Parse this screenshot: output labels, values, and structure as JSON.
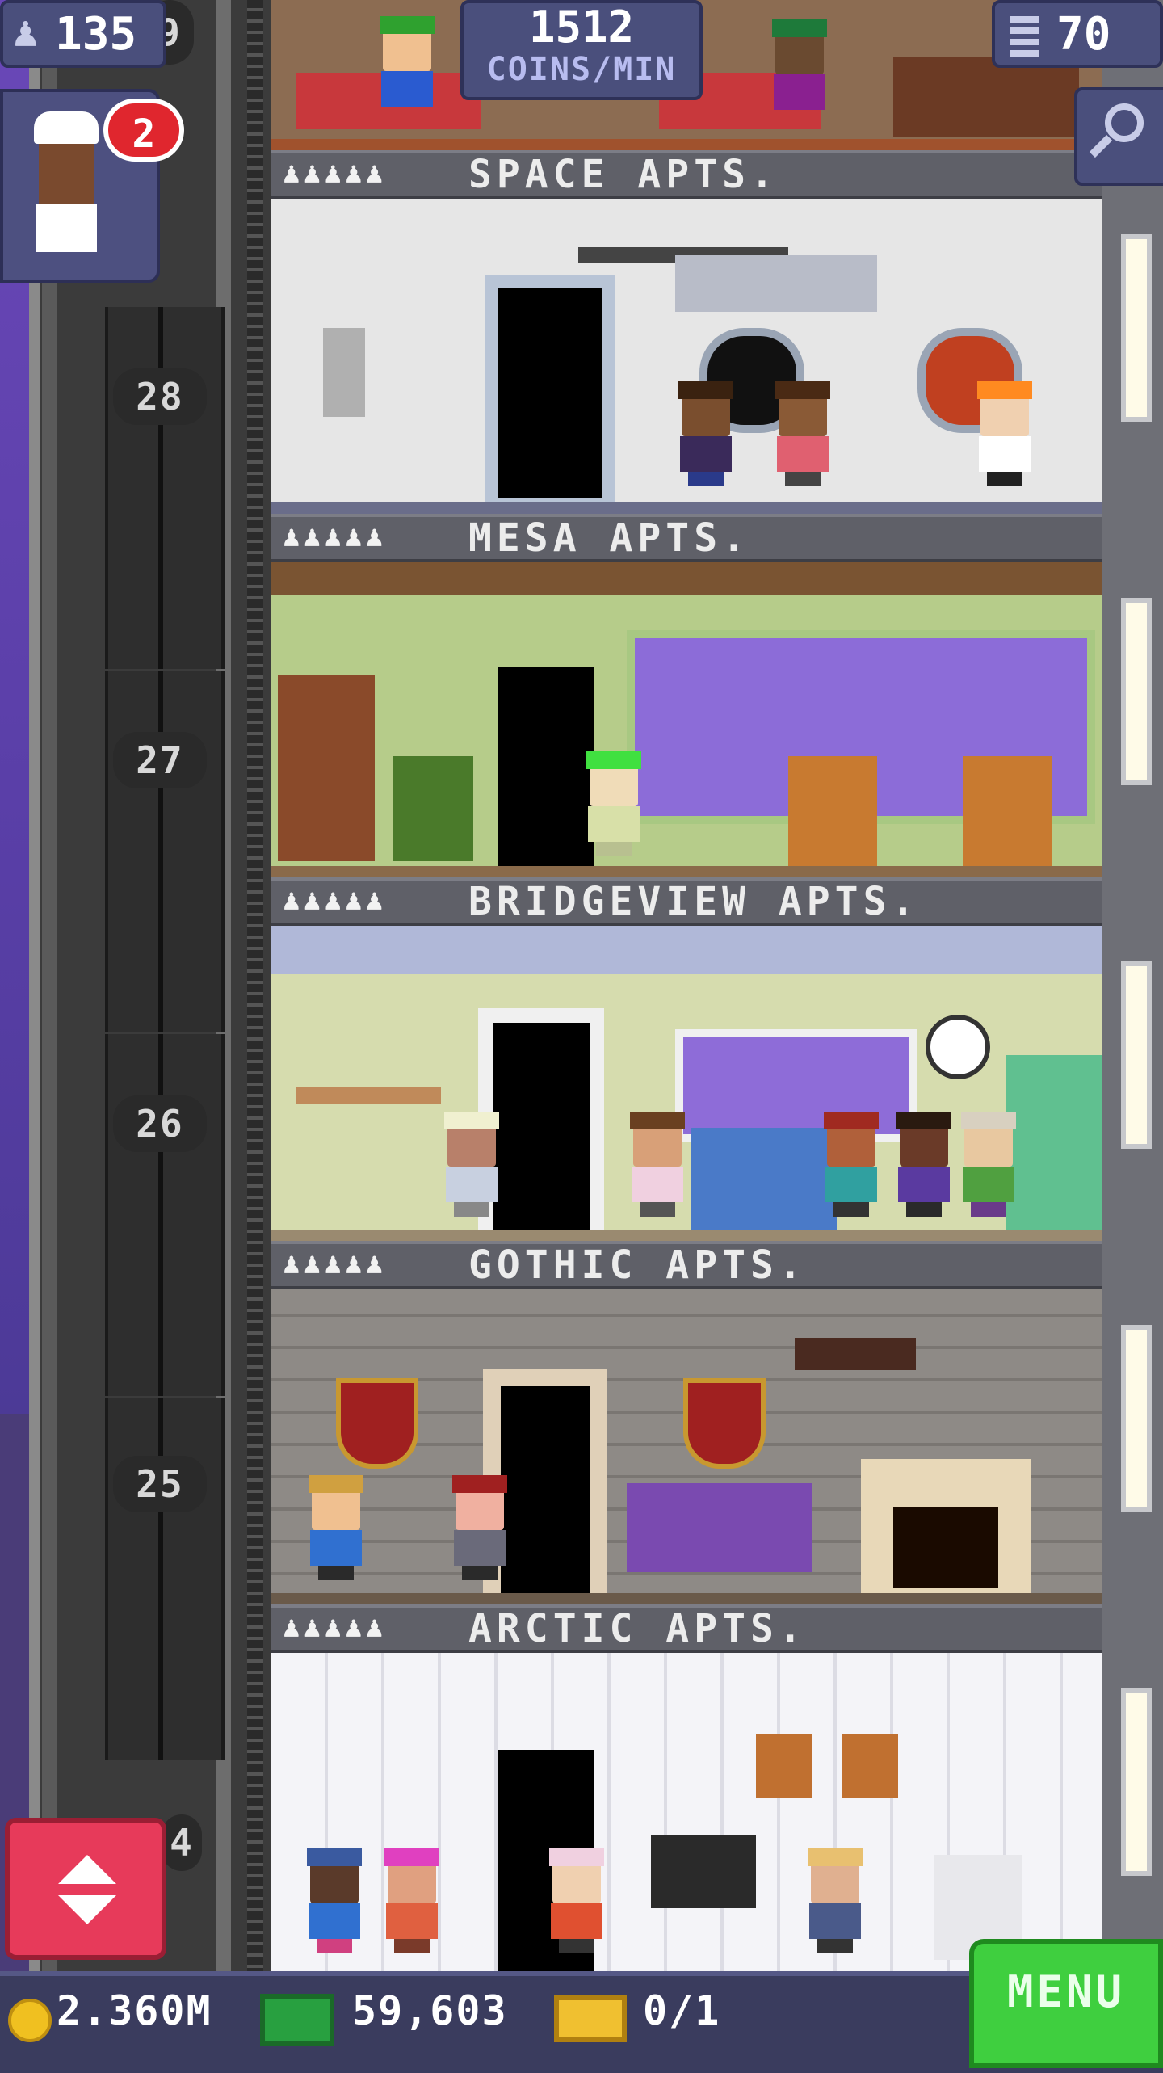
{
  "hud": {
    "population": "135",
    "floor_count": "70",
    "income_value": "1512",
    "income_unit": "COINS/MIN",
    "vip_badge": "2"
  },
  "resources": {
    "coins": "2.360M",
    "bux": "59,603",
    "tickets": "0/1",
    "menu_label": "MENU"
  },
  "shaft": {
    "top_partial_number": "9",
    "bottom_partial_number": "4",
    "floor_numbers": [
      "28",
      "27",
      "26",
      "25"
    ]
  },
  "floors": [
    {
      "label": "SPACE APTS.",
      "residents_icons": "♟♟♟♟♟"
    },
    {
      "label": "MESA APTS.",
      "residents_icons": "♟♟♟♟♟"
    },
    {
      "label": "BRIDGEVIEW APTS.",
      "residents_icons": "♟♟♟♟♟"
    },
    {
      "label": "GOTHIC APTS.",
      "residents_icons": "♟♟♟♟♟"
    },
    {
      "label": "ARCTIC APTS.",
      "residents_icons": "♟♟♟♟♟"
    }
  ],
  "icons": {
    "population": "person-up-icon",
    "floors": "building-icon",
    "search": "magnifier-icon",
    "coin": "coin-icon",
    "bux": "bux-icon",
    "ticket": "ticket-icon",
    "elevator": "up-down-arrows-icon"
  },
  "colors": {
    "menu_green": "#3fcf3f",
    "elevator_red": "#e73a5a",
    "badge_red": "#e0262e",
    "hud_blue": "#4a4f7c"
  }
}
